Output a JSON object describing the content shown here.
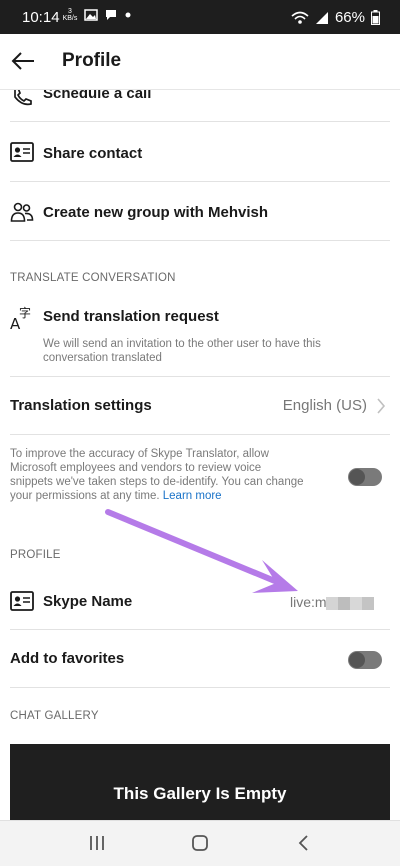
{
  "status_bar": {
    "time": "10:14",
    "net_speed_value": "3",
    "net_speed_unit": "KB/s",
    "battery": "66%",
    "icons": [
      "image-icon",
      "chat-icon",
      "dot-icon",
      "wifi-icon",
      "signal-icon",
      "battery-icon"
    ]
  },
  "header": {
    "title": "Profile"
  },
  "actions": {
    "schedule": "Schedule a call",
    "share": "Share contact",
    "create_group": "Create new group with Mehvish"
  },
  "translate": {
    "section": "TRANSLATE CONVERSATION",
    "send_label": "Send translation request",
    "send_desc_1": "We will send an invitation to the other user to have this",
    "send_desc_2": "conversation translated",
    "settings_label": "Translation settings",
    "settings_value": "English (US)",
    "improve_1": "To improve the accuracy of Skype Translator, allow",
    "improve_2": "Microsoft employees and vendors to review voice",
    "improve_3": "snippets we've taken steps to de-identify. You can change",
    "improve_4": "your permissions at any time.",
    "learn_more": "Learn more",
    "improve_toggle_on": false
  },
  "profile": {
    "section": "PROFILE",
    "skype_name_label": "Skype Name",
    "skype_name_value": "live:m",
    "favorites_label": "Add to favorites",
    "favorites_on": false
  },
  "gallery": {
    "section": "CHAT GALLERY",
    "empty_title": "This Gallery Is Empty"
  },
  "colors": {
    "arrow": "#b57be8",
    "link": "#1a73c8",
    "gallery_bg": "#1f1f1f"
  }
}
